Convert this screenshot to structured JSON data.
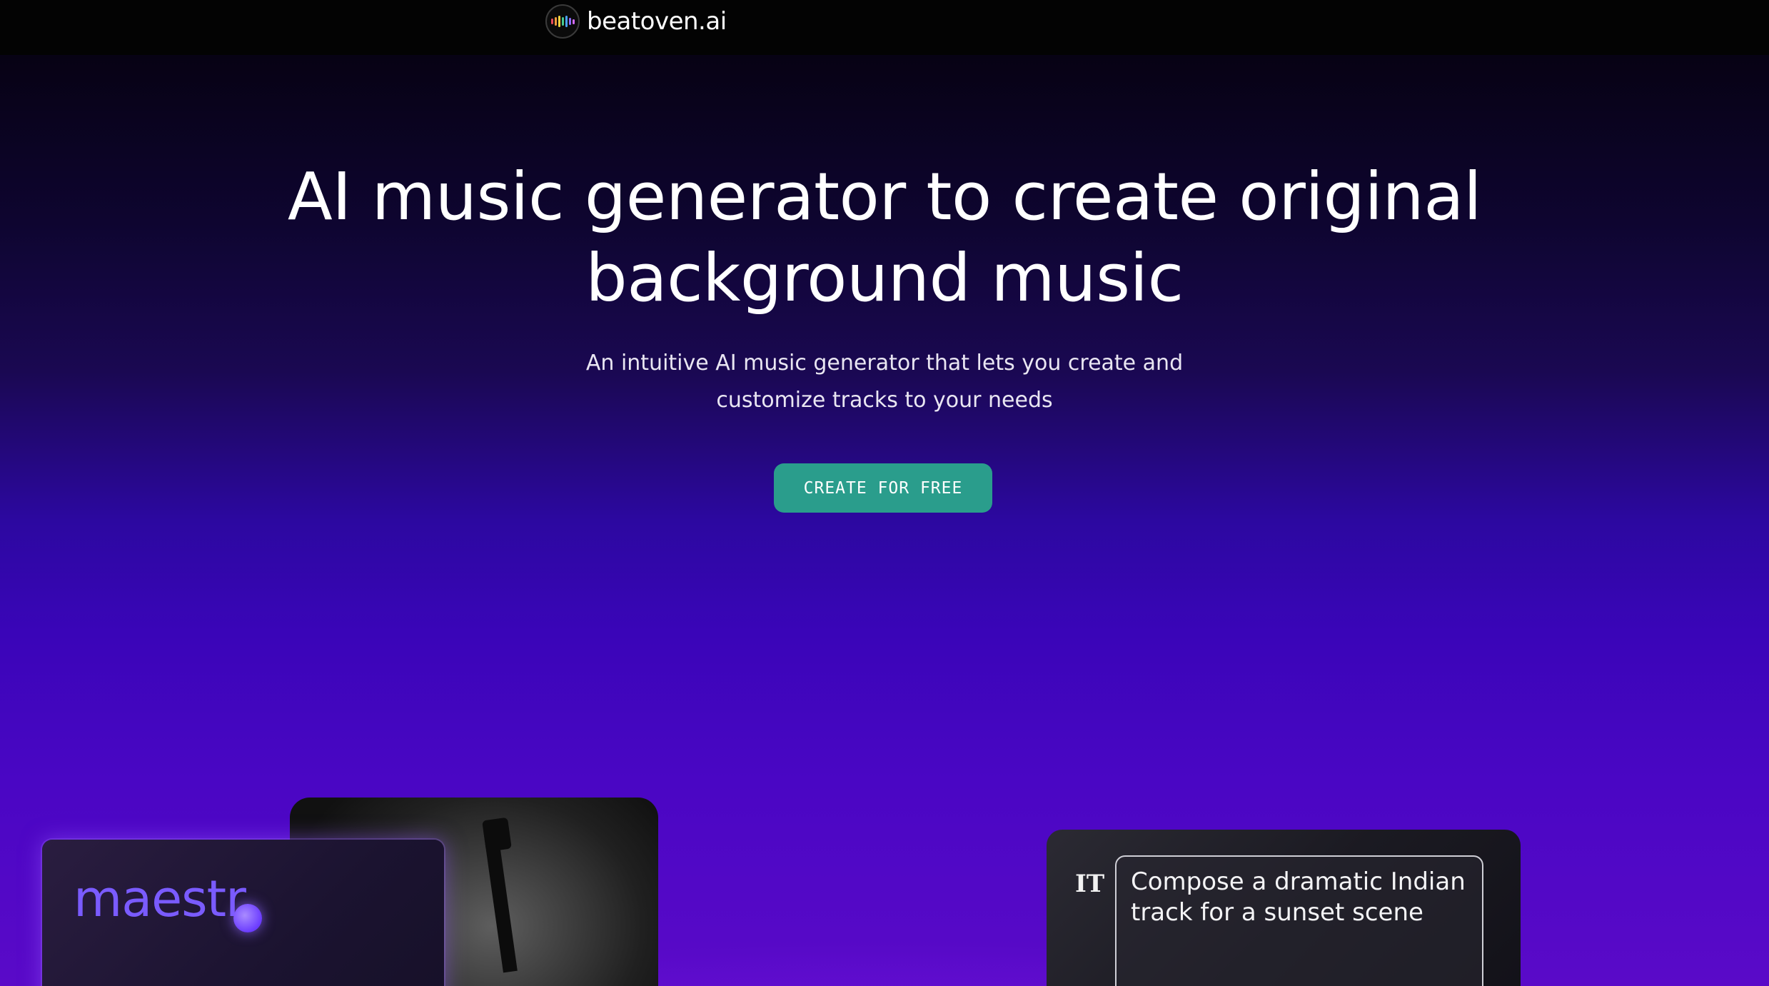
{
  "header": {
    "brand_name": "beatoven.ai",
    "logo_icon": "beatoven-logo-icon",
    "logo_bar_colors": [
      "#e94b5c",
      "#f39c3d",
      "#f5d342",
      "#47c98f",
      "#4aa3ff",
      "#8f6bff",
      "#d46bff"
    ]
  },
  "hero": {
    "headline_line1": "AI music generator to create original",
    "headline_line2": "background music",
    "subline_line1": "An intuitive AI music generator that lets you create and",
    "subline_line2": "customize tracks to your needs",
    "cta_label": "CREATE FOR FREE",
    "cta_color": "#2a9d8c"
  },
  "cards": {
    "maestro_word": "maestr",
    "prompt_icon_label": "IT",
    "prompt_text": "Compose a dramatic Indian track for a sunset scene"
  }
}
